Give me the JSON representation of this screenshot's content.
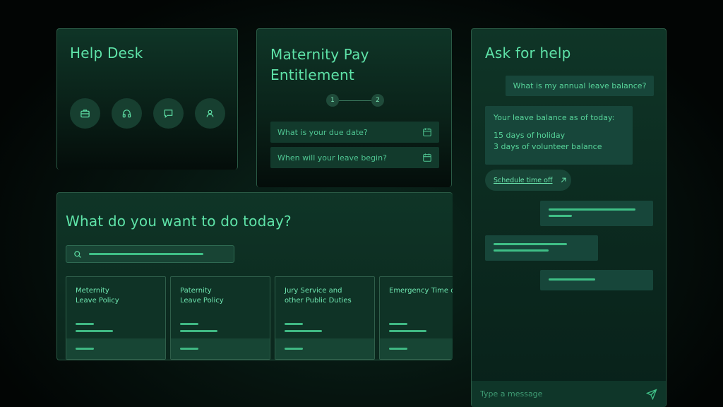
{
  "help_desk": {
    "title": "Help Desk",
    "icons": [
      "briefcase-icon",
      "headphones-icon",
      "chat-icon",
      "user-icon"
    ]
  },
  "maternity": {
    "title_line1": "Maternity Pay",
    "title_line2": "Entitlement",
    "steps": [
      "1",
      "2"
    ],
    "due_date_placeholder": "What is your due date?",
    "leave_begin_placeholder": "When will your leave begin?"
  },
  "todo": {
    "title": "What do you want to do today?",
    "cards": [
      {
        "title": "Meternity\nLeave Policy"
      },
      {
        "title": "Paternity\nLeave Policy"
      },
      {
        "title": "Jury Service and\nother Public Duties"
      },
      {
        "title": "Emergency Time off"
      }
    ]
  },
  "ask": {
    "title": "Ask for help",
    "user_question": "What is my annual leave balance?",
    "reply_heading": "Your leave balance as of today:",
    "reply_line1": "15 days of holiday",
    "reply_line2": "3 days of volunteer balance",
    "schedule_label": "Schedule time off",
    "message_placeholder": "Type a message"
  },
  "colors": {
    "accent": "#5ee3a8",
    "panel_bg": "#0f3527",
    "background": "#020504"
  }
}
